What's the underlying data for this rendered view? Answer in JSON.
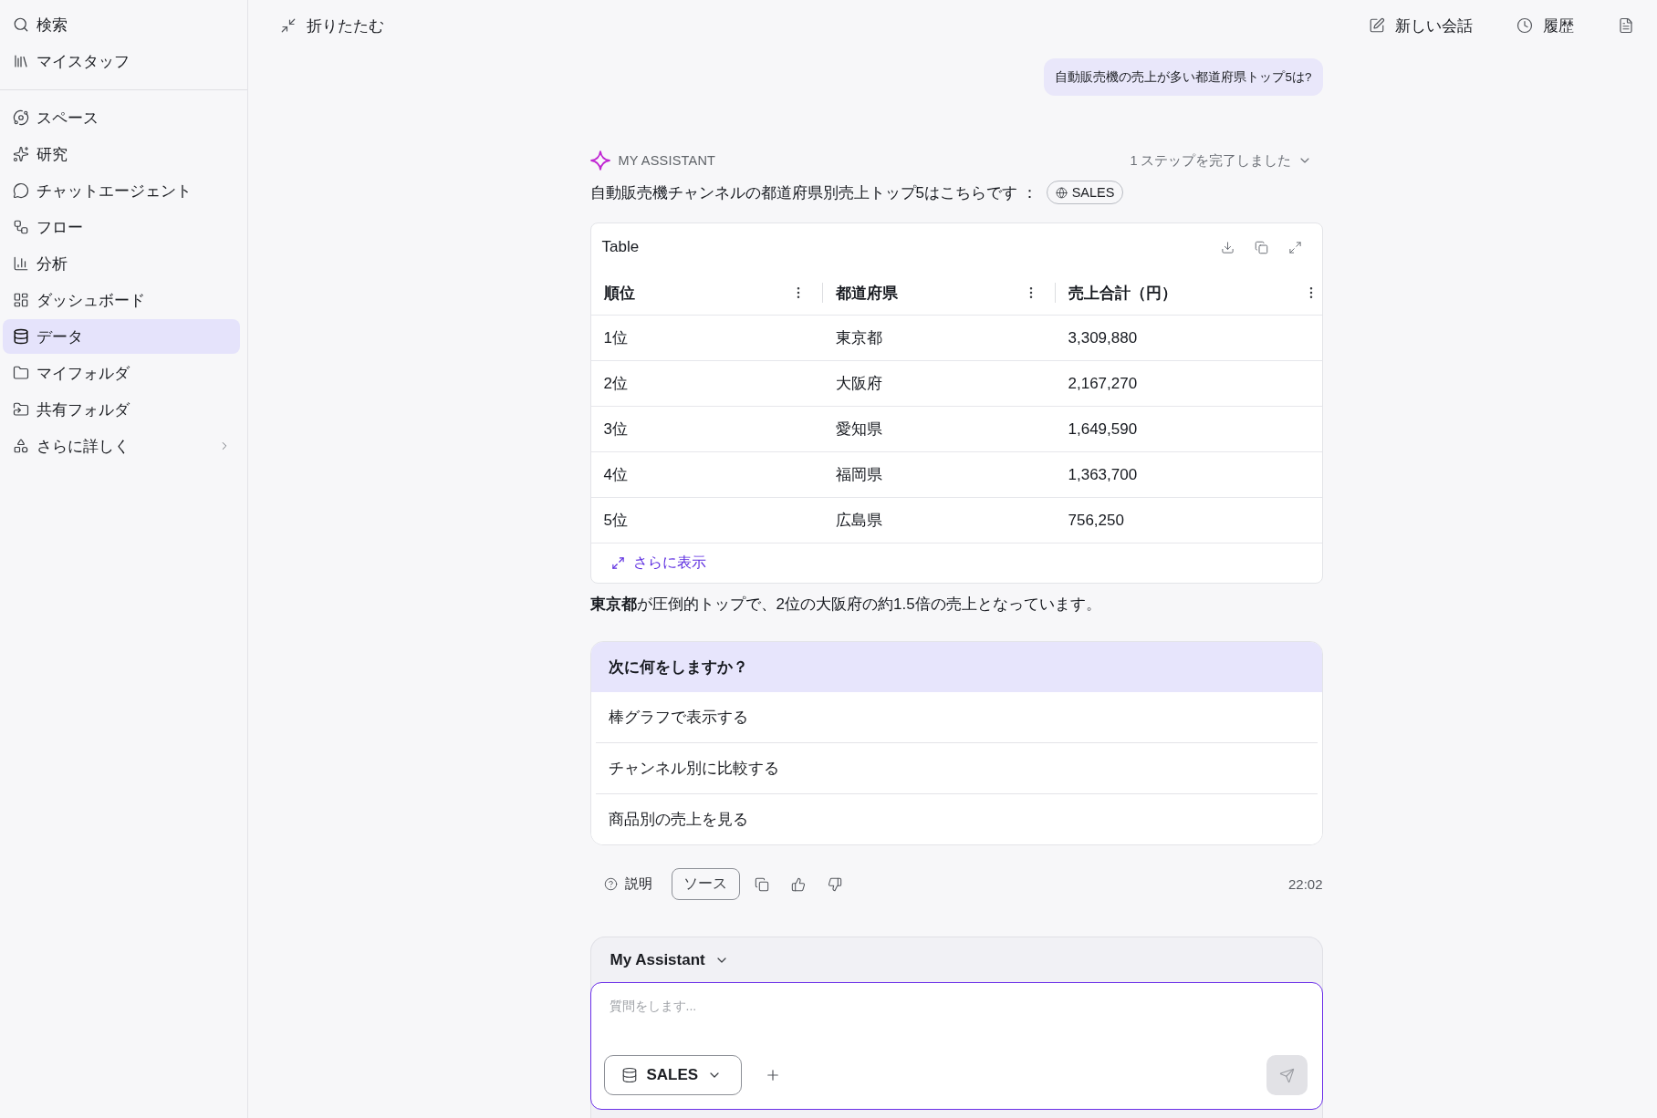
{
  "sidebar": {
    "top_items": [
      {
        "label": "検索",
        "selected": false
      },
      {
        "label": "マイスタッフ",
        "selected": false
      }
    ],
    "items": [
      {
        "label": "スペース",
        "selected": false
      },
      {
        "label": "研究",
        "selected": false
      },
      {
        "label": "チャットエージェント",
        "selected": false
      },
      {
        "label": "フロー",
        "selected": false
      },
      {
        "label": "分析",
        "selected": false
      },
      {
        "label": "ダッシュボード",
        "selected": false
      },
      {
        "label": "データ",
        "selected": true
      },
      {
        "label": "マイフォルダ",
        "selected": false
      },
      {
        "label": "共有フォルダ",
        "selected": false
      }
    ],
    "more": {
      "label": "さらに詳しく",
      "expanded": false
    }
  },
  "header": {
    "collapse": "折りたたむ",
    "new_chat": "新しい会話",
    "history": "履歴"
  },
  "conversation": {
    "user_message": "自動販売機の売上が多い都道府県トップ5は?",
    "assistant": {
      "name": "MY ASSISTANT",
      "steps": "1 ステップを完了しました",
      "steps_expanded": false,
      "intro": "自動販売機チャンネルの都道府県別売上トップ5はこちらです ：",
      "source_chip": "SALES",
      "table": {
        "title": "Table",
        "columns": [
          "順位",
          "都道府県",
          "売上合計（円）"
        ],
        "rows": [
          [
            "1位",
            "東京都",
            "3,309,880"
          ],
          [
            "2位",
            "大阪府",
            "2,167,270"
          ],
          [
            "3位",
            "愛知県",
            "1,649,590"
          ],
          [
            "4位",
            "福岡県",
            "1,363,700"
          ],
          [
            "5位",
            "広島県",
            "756,250"
          ]
        ],
        "more": "さらに表示"
      },
      "summary": "**東京都**が圧倒的トップで、2位の大阪府の約1.5倍の売上となっています。",
      "next_steps": {
        "title": "次に何をしますか？",
        "items": [
          "棒グラフで表示する",
          "チャンネル別に比較する",
          "商品別の売上を見る"
        ]
      },
      "actions": {
        "explain": "説明",
        "source": "ソース",
        "time": "22:02"
      }
    }
  },
  "composer": {
    "agent": "My Assistant",
    "placeholder": "質問をします...",
    "source": "SALES",
    "send_disabled": true
  }
}
